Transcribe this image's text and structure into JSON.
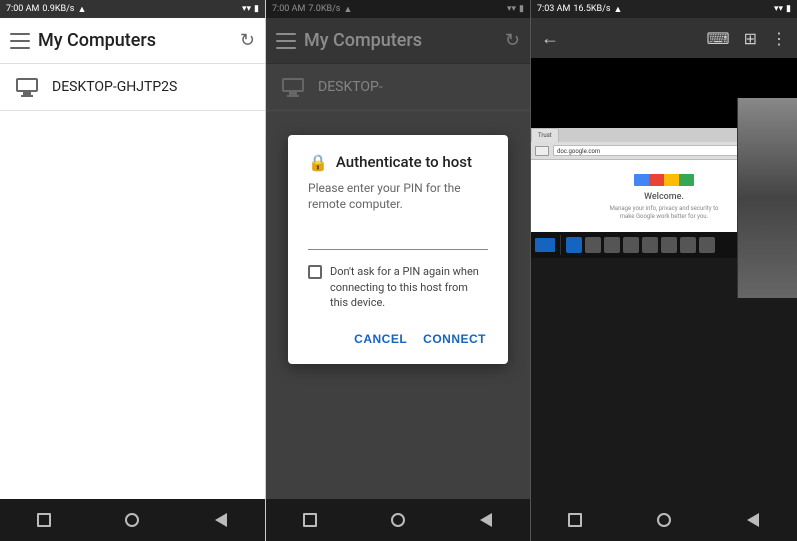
{
  "panel1": {
    "status": {
      "time": "7:00 AM",
      "data": "0.9KB/s",
      "signal": "▲",
      "wifi": "WiFi",
      "battery": "🔋"
    },
    "appbar": {
      "title": "My Computers",
      "menu_label": "Menu",
      "refresh_label": "Refresh"
    },
    "computers": [
      {
        "name": "DESKTOP-GHJTP2S"
      }
    ],
    "navbar": {
      "square": "□",
      "circle": "○",
      "back": "◁"
    }
  },
  "panel2": {
    "status": {
      "time": "7:00 AM",
      "data": "7.0KB/s",
      "signal": "▲",
      "wifi": "WiFi",
      "battery": "🔋"
    },
    "appbar": {
      "title": "My Computers",
      "menu_label": "Menu",
      "refresh_label": "Refresh"
    },
    "computers": [
      {
        "name": "DESKTOP-"
      }
    ],
    "dialog": {
      "title": "Authenticate to host",
      "subtitle": "Please enter your PIN for the remote computer.",
      "pin_placeholder": "",
      "checkbox_label": "Don't ask for a PIN again when connecting to this host from this device.",
      "cancel_label": "CANCEL",
      "connect_label": "CONNECT"
    },
    "navbar": {
      "square": "□",
      "circle": "○",
      "back": "◁"
    }
  },
  "panel3": {
    "status": {
      "time": "7:03 AM",
      "data": "16.5KB/s",
      "signal": "▲",
      "wifi": "WiFi",
      "battery": "🔋"
    },
    "appbar": {
      "back_label": "Back",
      "keyboard_label": "Keyboard",
      "menu_label": "Menu",
      "more_label": "More"
    },
    "remote": {
      "browser_url": "doc.google.com",
      "tab_label": "Trust",
      "welcome_heading": "Welcome.",
      "welcome_text": "Manage your info, privacy and security to make Google work better for you."
    },
    "navbar": {
      "square": "□",
      "circle": "○",
      "back": "◁"
    }
  }
}
